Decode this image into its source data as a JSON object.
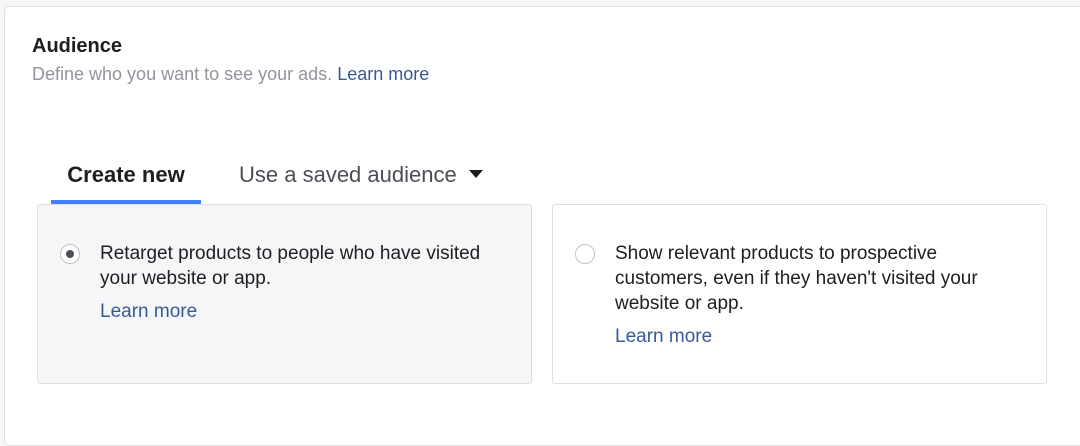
{
  "section": {
    "title": "Audience",
    "subtitle": "Define who you want to see your ads.",
    "subtitle_link": "Learn more"
  },
  "tabs": [
    {
      "label": "Create new",
      "active": true
    },
    {
      "label": "Use a saved audience",
      "has_dropdown": true,
      "active": false
    }
  ],
  "options": [
    {
      "text": "Retarget products to people who have visited your website or app.",
      "link": "Learn more",
      "selected": true
    },
    {
      "text": "Show relevant products to prospective customers, even if they haven't visited your website or app.",
      "link": "Learn more",
      "selected": false
    }
  ],
  "colors": {
    "link": "#385898",
    "active_tab_underline": "#4080ff",
    "selected_card_bg": "#f5f6f7"
  },
  "icons": [
    "caret-down-icon",
    "radio-checked-icon",
    "radio-unchecked-icon"
  ]
}
